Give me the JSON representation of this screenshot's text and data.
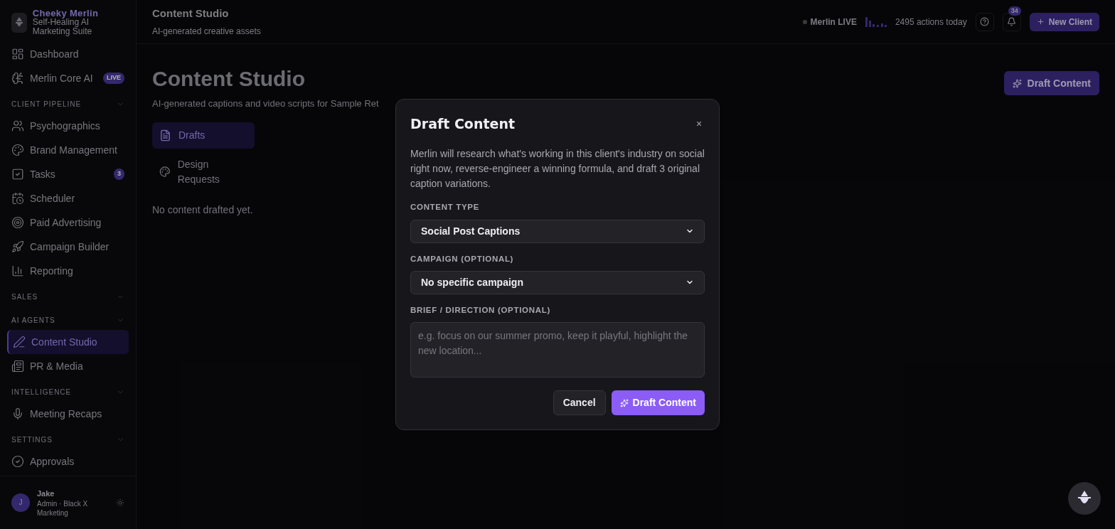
{
  "brand": {
    "name": "Cheeky Merlin",
    "tagline": "Self-Healing AI Marketing Suite"
  },
  "sidebar": {
    "sections": [
      {
        "items": [
          {
            "label": "Dashboard",
            "selected": false
          },
          {
            "label": "Merlin Core AI",
            "badge": "LIVE",
            "selected": false
          }
        ]
      },
      {
        "title": "CLIENT PIPELINE",
        "items": [
          {
            "label": "Psychographics",
            "selected": false
          },
          {
            "label": "Brand Management",
            "selected": false
          },
          {
            "label": "Tasks",
            "badge": "3",
            "selected": false
          },
          {
            "label": "Scheduler",
            "selected": false
          },
          {
            "label": "Paid Advertising",
            "selected": false
          },
          {
            "label": "Campaign Builder",
            "selected": false
          },
          {
            "label": "Reporting",
            "selected": false
          }
        ]
      },
      {
        "title": "SALES"
      },
      {
        "title": "AI AGENTS",
        "items": [
          {
            "label": "Content Studio",
            "selected": true
          },
          {
            "label": "PR & Media",
            "selected": false
          }
        ]
      },
      {
        "title": "INTELLIGENCE",
        "items": [
          {
            "label": "Meeting Recaps",
            "selected": false
          }
        ]
      },
      {
        "title": "SETTINGS",
        "items": [
          {
            "label": "Approvals",
            "selected": false
          }
        ]
      }
    ],
    "user": {
      "initial": "J",
      "name": "Jake",
      "role": "Admin · Black X Marketing"
    }
  },
  "header": {
    "title": "Content Studio",
    "subtitle": "AI-generated creative assets",
    "status": "Merlin LIVE",
    "activity": "2495 actions today",
    "notifications": "34",
    "button": "New Client"
  },
  "page": {
    "title": "Content Studio",
    "subtitle": "AI-generated captions and video scripts for Sample Ret",
    "action": "Draft Content",
    "tabs": [
      {
        "label": "Drafts",
        "selected": true
      },
      {
        "label": "Design Requests",
        "selected": false
      }
    ],
    "empty": "No content drafted yet."
  },
  "dialog": {
    "title": "Draft Content",
    "close": "×",
    "description": "Merlin will research what's working in this client's industry on social right now, reverse-engineer a winning formula, and draft 3 original caption variations.",
    "fields": [
      {
        "kind": "select",
        "label": "CONTENT TYPE",
        "value": "Social Post Captions"
      },
      {
        "kind": "select",
        "label": "CAMPAIGN (OPTIONAL)",
        "value": "No specific campaign"
      },
      {
        "kind": "textarea",
        "label": "BRIEF / DIRECTION (OPTIONAL)",
        "placeholder": "e.g. focus on our summer promo, keep it playful, highlight the new location..."
      }
    ],
    "buttons": [
      {
        "kind": "secondary",
        "label": "Cancel"
      },
      {
        "kind": "primary",
        "label": "Draft Content"
      }
    ]
  }
}
